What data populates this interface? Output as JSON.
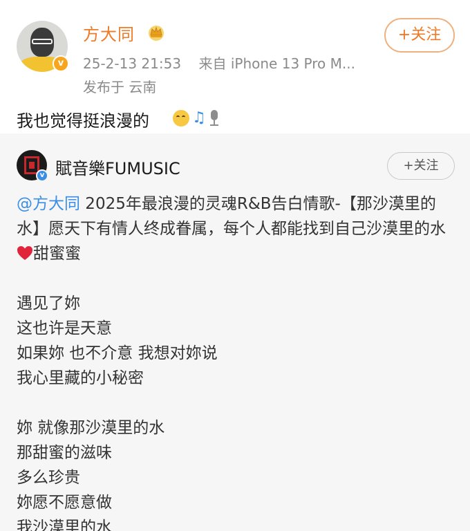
{
  "post": {
    "author": "方大同",
    "time": "25-2-13 21:53",
    "source": "来自 iPhone 13 Pro M...",
    "location": "发布于 云南",
    "follow_label": "+关注",
    "text": "我也觉得挺浪漫的"
  },
  "repost": {
    "author": "賦音樂FUMUSIC",
    "follow_label": "+关注",
    "mention": "@方大同",
    "body_a": " 2025年最浪漫的灵魂R&B告白情歌-【那沙漠里的水】愿天下有情人终成眷属，每个人都能找到自己沙漠里的水",
    "body_b": "甜蜜蜜",
    "lyrics": {
      "verse1": [
        "遇见了妳",
        "这也许是天意",
        "如果妳  也不介意  我想对妳说",
        "我心里藏的小秘密"
      ],
      "verse2": [
        "妳  就像那沙漠里的水",
        "那甜蜜的滋味",
        "多么珍贵",
        "妳愿不愿意做",
        "我沙漠里的水"
      ]
    }
  },
  "colors": {
    "accent_orange": "#ef7a25",
    "link_blue": "#3b8ee6",
    "repost_bg": "#f6f6f6"
  },
  "icons": [
    "vip-crown-icon",
    "verified-badge-icon",
    "smile-emoji-icon",
    "music-note-icon",
    "microphone-icon",
    "red-heart-icon"
  ]
}
